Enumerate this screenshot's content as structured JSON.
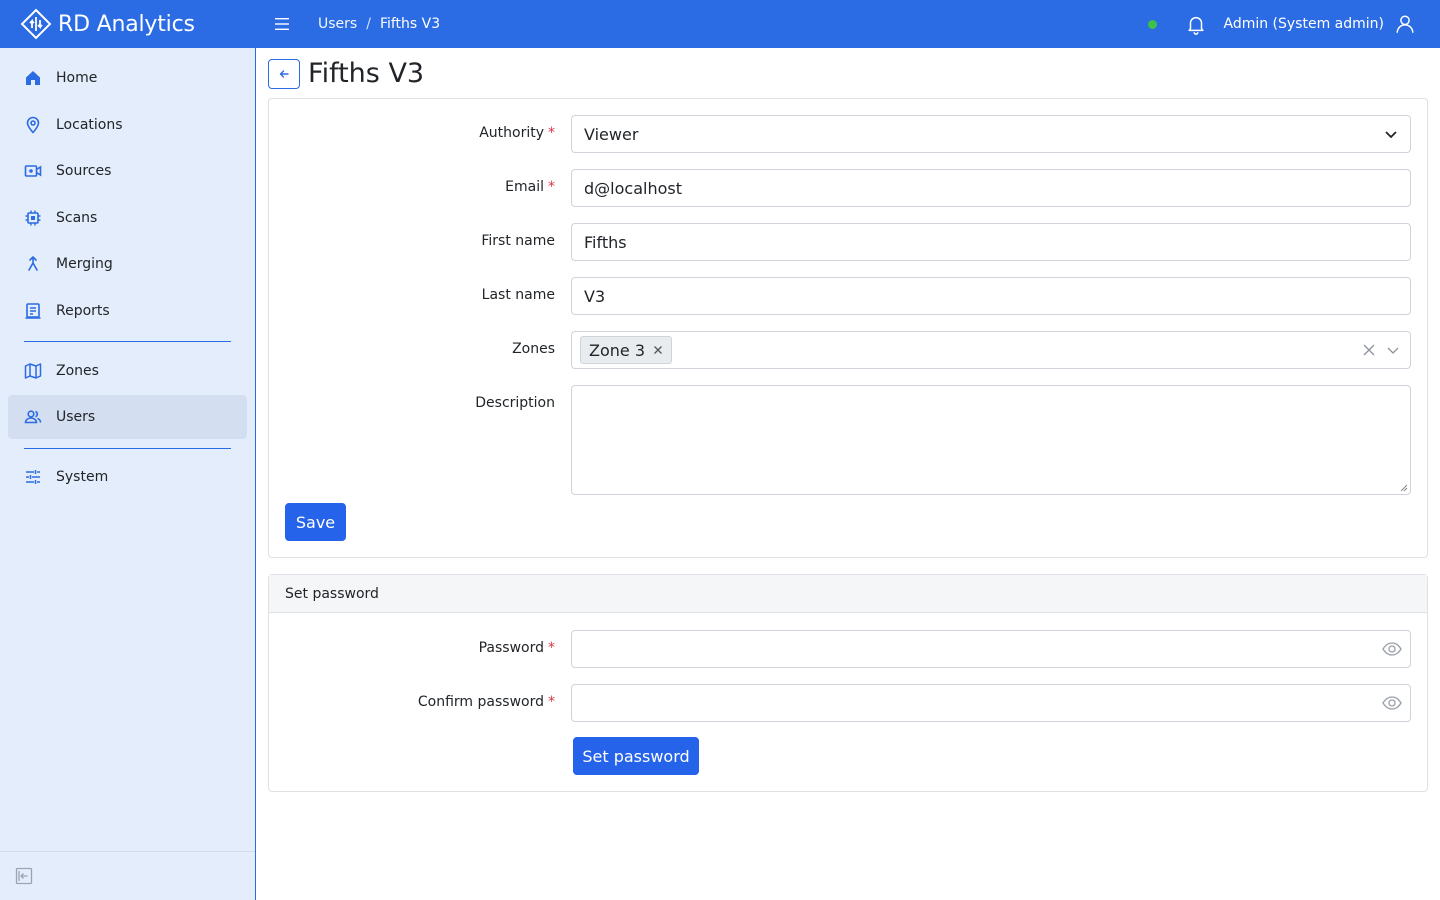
{
  "app": {
    "brand": "RD Analytics"
  },
  "breadcrumb": {
    "parent": "Users",
    "separator": "/",
    "current": "Fifths V3"
  },
  "header": {
    "user": "Admin (System admin)",
    "status_color": "#3ec14a"
  },
  "sidebar": {
    "items": [
      {
        "label": "Home",
        "icon": "home-icon"
      },
      {
        "label": "Locations",
        "icon": "map-pin-icon"
      },
      {
        "label": "Sources",
        "icon": "camera-icon"
      },
      {
        "label": "Scans",
        "icon": "chip-icon"
      },
      {
        "label": "Merging",
        "icon": "merge-icon"
      },
      {
        "label": "Reports",
        "icon": "report-icon"
      },
      {
        "label": "Zones",
        "icon": "map-icon"
      },
      {
        "label": "Users",
        "icon": "users-icon",
        "active": true
      },
      {
        "label": "System",
        "icon": "sliders-icon"
      }
    ]
  },
  "page": {
    "title": "Fifths V3"
  },
  "form": {
    "authority": {
      "label": "Authority",
      "value": "Viewer"
    },
    "email": {
      "label": "Email",
      "value": "d@localhost"
    },
    "first_name": {
      "label": "First name",
      "value": "Fifths"
    },
    "last_name": {
      "label": "Last name",
      "value": "V3"
    },
    "zones": {
      "label": "Zones",
      "chips": [
        "Zone 3"
      ]
    },
    "description": {
      "label": "Description",
      "value": ""
    },
    "save_label": "Save"
  },
  "password": {
    "header": "Set password",
    "password_label": "Password",
    "confirm_label": "Confirm password",
    "button_label": "Set password"
  },
  "colors": {
    "primary": "#2b6be3",
    "sidebar_bg": "#e4edfb",
    "required": "#dc3545"
  }
}
